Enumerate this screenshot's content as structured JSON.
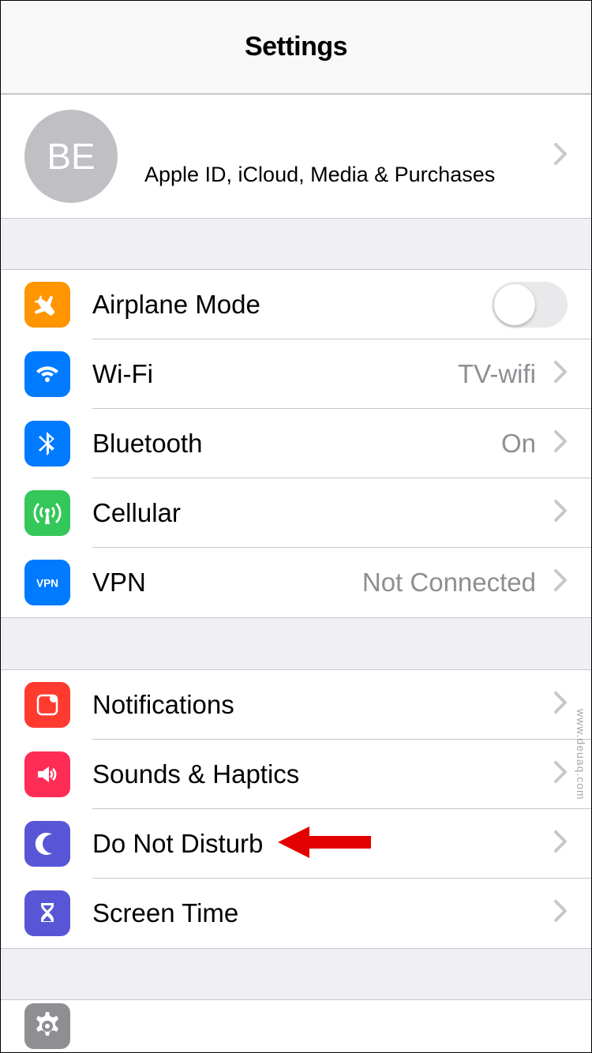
{
  "navbar": {
    "title": "Settings"
  },
  "profile": {
    "initials": "BE",
    "subtitle": "Apple ID, iCloud, Media & Purchases"
  },
  "section_network": {
    "airplane": {
      "label": "Airplane Mode",
      "on": false
    },
    "wifi": {
      "label": "Wi-Fi",
      "detail": "TV-wifi"
    },
    "bluetooth": {
      "label": "Bluetooth",
      "detail": "On"
    },
    "cellular": {
      "label": "Cellular"
    },
    "vpn": {
      "label": "VPN",
      "detail": "Not Connected"
    }
  },
  "section_general": {
    "notifications": {
      "label": "Notifications"
    },
    "sounds": {
      "label": "Sounds & Haptics"
    },
    "dnd": {
      "label": "Do Not Disturb"
    },
    "screentime": {
      "label": "Screen Time"
    }
  },
  "section_next": {
    "general": {
      "label": "General"
    }
  },
  "colors": {
    "orange": "#ff9500",
    "blue": "#007aff",
    "green": "#34c759",
    "blue2": "#007aff",
    "red": "#ff3b30",
    "pink": "#ff2d55",
    "purple": "#5856d6",
    "purple2": "#5856d6",
    "gray": "#8e8e93"
  },
  "annotation": {
    "type": "arrow",
    "target": "dnd"
  },
  "watermark": "www.deuaq.com"
}
